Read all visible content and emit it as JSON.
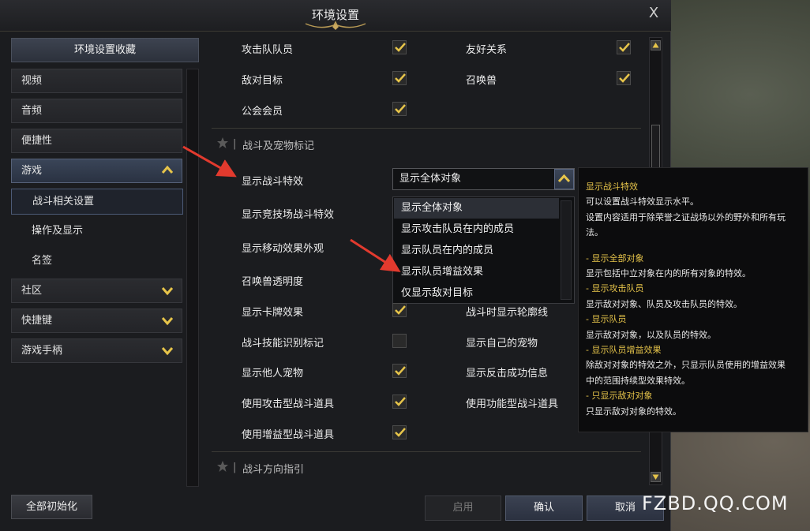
{
  "window": {
    "title": "环境设置",
    "close_label": "X"
  },
  "sidebar": {
    "favorites_label": "环境设置收藏",
    "items": [
      {
        "label": "视频"
      },
      {
        "label": "音频"
      },
      {
        "label": "便捷性"
      },
      {
        "label": "游戏"
      },
      {
        "label": "社区"
      },
      {
        "label": "快捷键"
      },
      {
        "label": "游戏手柄"
      }
    ],
    "sub_items": [
      {
        "label": "战斗相关设置"
      },
      {
        "label": "操作及显示"
      },
      {
        "label": "名签"
      }
    ],
    "reset_label": "全部初始化"
  },
  "content": {
    "top_options": [
      {
        "label": "攻击队队员",
        "checked": true
      },
      {
        "label": "友好关系",
        "checked": true
      },
      {
        "label": "敌对目标",
        "checked": true
      },
      {
        "label": "召唤兽",
        "checked": true
      },
      {
        "label": "公会会员",
        "checked": true
      }
    ],
    "section1_title": "战斗及宠物标记",
    "rows": [
      {
        "label": "显示战斗特效"
      },
      {
        "label": "显示竞技场战斗特效"
      },
      {
        "label": "显示移动效果外观"
      },
      {
        "label": "召唤兽透明度"
      }
    ],
    "dropdown": {
      "value": "显示全体对象",
      "options": [
        "显示全体对象",
        "显示攻击队员在内的成员",
        "显示队员在内的成员",
        "显示队员增益效果",
        "仅显示敌对目标"
      ]
    },
    "checks": [
      {
        "label": "显示卡牌效果",
        "checked": true
      },
      {
        "label": "战斗时显示轮廓线",
        "checked": false
      },
      {
        "label": "战斗技能识别标记",
        "checked": false
      },
      {
        "label": "显示自己的宠物",
        "checked": false
      },
      {
        "label": "显示他人宠物",
        "checked": true
      },
      {
        "label": "显示反击成功信息",
        "checked": false
      },
      {
        "label": "使用攻击型战斗道具",
        "checked": true
      },
      {
        "label": "使用功能型战斗道具",
        "checked": false
      },
      {
        "label": "使用增益型战斗道具",
        "checked": true
      }
    ],
    "section2_title": "战斗方向指引"
  },
  "buttons": {
    "apply": "启用",
    "ok": "确认",
    "cancel": "取消"
  },
  "tooltip": {
    "title": "显示战斗特效",
    "line1": "可以设置战斗特效显示水平。",
    "line2": "设置内容适用于除荣誉之证战场以外的野外和所有玩",
    "line3": "法。",
    "h1": "- 显示全部对象",
    "d1": "显示包括中立对象在内的所有对象的特效。",
    "h2": "- 显示攻击队员",
    "d2": "显示敌对对象、队员及攻击队员的特效。",
    "h3": "- 显示队员",
    "d3": "显示敌对对象，以及队员的特效。",
    "h4": "- 显示队员增益效果",
    "d4a": "除敌对对象的特效之外，只显示队员使用的增益效果",
    "d4b": "中的范围持续型效果特效。",
    "h5": "- 只显示敌对对象",
    "d5": "只显示敌对对象的特效。"
  },
  "watermark": "FZBD.QQ.COM",
  "colors": {
    "accent_yellow": "#e6c44a",
    "selected_blue": "#3a4558",
    "annotation_red": "#e23a2e"
  }
}
